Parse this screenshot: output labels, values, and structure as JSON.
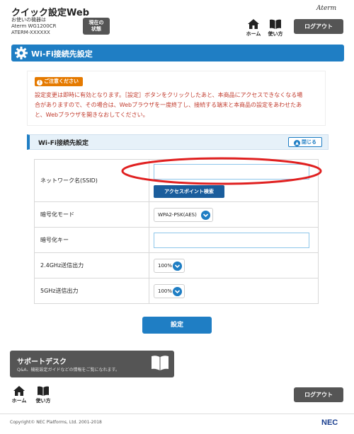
{
  "header": {
    "app_title": "クイック設定Web",
    "device_line1": "お使いの機器は",
    "device_line2": "Aterm WG1200CR",
    "device_line3": "ATERM-XXXXXX",
    "status_label1": "現在の",
    "status_label2": "状態",
    "home_label": "ホーム",
    "usage_label": "使い方",
    "brand": "Aterm",
    "logout_label": "ログアウト"
  },
  "page": {
    "title": "Wi-Fi接続先設定"
  },
  "notice": {
    "badge": "ご注意ください",
    "line1": "設定変更は即時に有効となります。［設定］ボタンをクリックしたあと、本商品にアクセスできなくなる場",
    "line2": "合がありますので、その場合は、Webブラウザを一度終了し、接続する端末と本商品の設定をあわせたあ",
    "line3": "と、Webブラウザを開きなおしてください。"
  },
  "section": {
    "title": "Wi-Fi接続先設定",
    "close_label": "閉じる"
  },
  "form": {
    "ssid_label": "ネットワーク名(SSID)",
    "ssid_value": "",
    "ap_search_label": "アクセスポイント検索",
    "enc_mode_label": "暗号化モード",
    "enc_mode_value": "WPA2-PSK(AES)",
    "enc_key_label": "暗号化キー",
    "enc_key_value": "",
    "power24_label": "2.4GHz送信出力",
    "power24_value": "100%",
    "power5_label": "5GHz送信出力",
    "power5_value": "100%",
    "submit_label": "設定"
  },
  "support": {
    "title": "サポートデスク",
    "subtitle": "Q&A、機能設定ガイドなどの情報をご覧になれます。"
  },
  "footer": {
    "home_label": "ホーム",
    "usage_label": "使い方",
    "logout_label": "ログアウト",
    "copyright": "Copyright© NEC Platforms, Ltd. 2001-2018",
    "nec": "NEC"
  },
  "colors": {
    "primary": "#1f7ec4",
    "dark_button": "#555555",
    "warning_text": "#c0392b",
    "badge": "#e57a00",
    "annotation": "#e02020"
  }
}
